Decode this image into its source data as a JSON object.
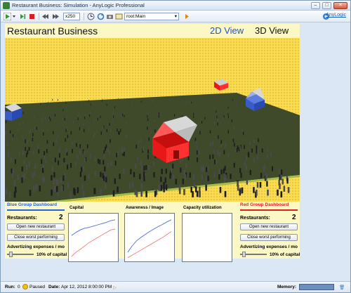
{
  "window": {
    "title": "Restaurant Business: Simulation - AnyLogic Professional",
    "buttons": {
      "minimize": "–",
      "maximize": "□",
      "close": "✕"
    }
  },
  "toolbar": {
    "speed": "x250",
    "experiment": "root:Main",
    "brand_link": "AnyLogic"
  },
  "model": {
    "title": "Restaurant Business",
    "view_2d": "2D View",
    "view_3d": "3D View"
  },
  "blue_dashboard": {
    "title": "Blue Group Dashboard",
    "color": "#2a63d6",
    "restaurants_label": "Restaurants:",
    "restaurants_count": "2",
    "open_button": "Open new restaurant",
    "close_button": "Close worst performing",
    "advertising_label": "Advertizing expenses / mo",
    "advertising_value": "10% of capital",
    "slider_level": 0.1
  },
  "red_dashboard": {
    "title": "Red Group Dashboard",
    "color": "#e02020",
    "restaurants_label": "Restaurants:",
    "restaurants_count": "2",
    "open_button": "Open new restaurant",
    "close_button": "Close worst performing",
    "advertising_label": "Advertizing expenses / mo",
    "advertising_value": "10% of capital",
    "slider_level": 0.1
  },
  "charts": {
    "capital": "Capital",
    "awareness": "Awareness / Image",
    "capacity": "Capacity utilization"
  },
  "chart_data": [
    {
      "type": "line",
      "title": "Capital",
      "x": [
        0,
        1,
        2,
        3,
        4,
        5,
        6,
        7,
        8,
        9,
        10
      ],
      "series": [
        {
          "values": [
            0.55,
            0.62,
            0.68,
            0.72,
            0.74,
            0.77,
            0.8,
            0.83,
            0.86,
            0.9,
            0.92
          ],
          "color": "#4a6ee0"
        },
        {
          "values": [
            0.05,
            0.15,
            0.22,
            0.3,
            0.38,
            0.44,
            0.5,
            0.56,
            0.62,
            0.68,
            0.7
          ],
          "color": "#f08080"
        }
      ],
      "ylim": [
        0,
        1
      ]
    },
    {
      "type": "line",
      "title": "Awareness / Image",
      "x": [
        0,
        1,
        2,
        3,
        4,
        5,
        6,
        7,
        8,
        9,
        10
      ],
      "series": [
        {
          "values": [
            0.15,
            0.3,
            0.42,
            0.5,
            0.57,
            0.64,
            0.7,
            0.76,
            0.81,
            0.87,
            0.92
          ],
          "color": "#4a6ee0"
        },
        {
          "values": [
            0.02,
            0.08,
            0.14,
            0.2,
            0.26,
            0.32,
            0.38,
            0.44,
            0.5,
            0.57,
            0.64
          ],
          "color": "#f08080"
        }
      ],
      "ylim": [
        0,
        1
      ]
    },
    {
      "type": "line",
      "title": "Capacity utilization",
      "x": [],
      "series": [],
      "ylim": [
        0,
        1
      ]
    }
  ],
  "status": {
    "run_label": "Run:",
    "run_value": "0",
    "state": "Paused",
    "date_label": "Date:",
    "date_value": "Apr 12, 2012 8:00:00 PM",
    "memory_label": "Memory:"
  },
  "colors": {
    "ground": "#3f4a2a",
    "sky": "#f7d23a",
    "house_red": "#e81818",
    "house_blue": "#3a5cc8"
  }
}
